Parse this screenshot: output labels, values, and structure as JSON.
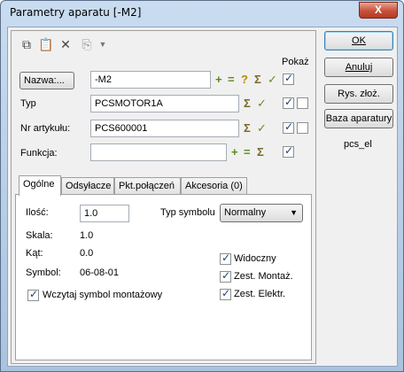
{
  "window": {
    "title": "Parametry aparatu [-M2]",
    "close_label": "X"
  },
  "toolbar": {
    "icons": [
      "copy-icon",
      "paste-icon",
      "delete-icon",
      "attach-icon",
      "dropdown-icon"
    ]
  },
  "fields": {
    "pokaz_label": "Pokaż",
    "nazwa": {
      "label": "Nazwa:...",
      "value": "-M2"
    },
    "typ": {
      "label": "Typ",
      "value": "PCSMOTOR1A"
    },
    "nr_artykulu": {
      "label": "Nr artykułu:",
      "value": "PCS600001"
    },
    "funkcja": {
      "label": "Funkcja:",
      "value": ""
    }
  },
  "symbols": {
    "plus": "+",
    "minus": "=",
    "question": "?",
    "sigma": "Σ",
    "check": "✓"
  },
  "tabs": [
    {
      "label": "Ogólne",
      "active": true
    },
    {
      "label": "Odsyłacze",
      "active": false
    },
    {
      "label": "Pkt.połączeń",
      "active": false
    },
    {
      "label": "Akcesoria (0)",
      "active": false
    }
  ],
  "general": {
    "ilosc_label": "Ilość:",
    "ilosc_value": "1.0",
    "typ_symbolu_label": "Typ symbolu",
    "typ_symbolu_value": "Normalny",
    "skala_label": "Skala:",
    "skala_value": "1.0",
    "kat_label": "Kąt:",
    "kat_value": "0.0",
    "symbol_label": "Symbol:",
    "symbol_value": "06-08-01",
    "wczytaj_label": "Wczytaj symbol montażowy",
    "widoczny_label": "Widoczny",
    "zest_montaz_label": "Zest. Montaż.",
    "zest_elektr_label": "Zest. Elektr."
  },
  "right": {
    "ok": "OK",
    "anuluj": "Anuluj",
    "rys": "Rys. złoż.",
    "baza": "Baza aparatury",
    "lib": "pcs_el"
  }
}
